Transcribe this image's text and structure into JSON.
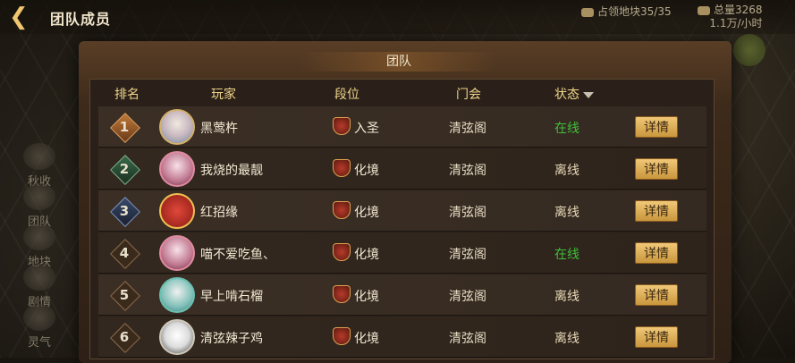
{
  "header": {
    "back_icon": "chevron-left-icon",
    "title": "团队成员",
    "territory": "占领地块35/35",
    "total": "总量3268",
    "rate": "1.1万/小时"
  },
  "side_menu": [
    "秋收",
    "团队",
    "地块",
    "剧情",
    "灵气"
  ],
  "panel": {
    "title": "团队",
    "columns": {
      "rank": "排名",
      "player": "玩家",
      "tier": "段位",
      "guild": "门会",
      "status": "状态"
    },
    "detail_label": "详情",
    "rows": [
      {
        "rank": "1",
        "name": "黑莺杵",
        "tier": "入圣",
        "guild": "清弦阁",
        "status": "在线"
      },
      {
        "rank": "2",
        "name": "我烧的最靓",
        "tier": "化境",
        "guild": "清弦阁",
        "status": "离线"
      },
      {
        "rank": "3",
        "name": "红招缘",
        "tier": "化境",
        "guild": "清弦阁",
        "status": "离线"
      },
      {
        "rank": "4",
        "name": "喵不爱吃鱼、",
        "tier": "化境",
        "guild": "清弦阁",
        "status": "在线"
      },
      {
        "rank": "5",
        "name": "早上啃石榴",
        "tier": "化境",
        "guild": "清弦阁",
        "status": "离线"
      },
      {
        "rank": "6",
        "name": "清弦辣子鸡",
        "tier": "化境",
        "guild": "清弦阁",
        "status": "离线"
      }
    ]
  },
  "colors": {
    "online": "#3fbf3a",
    "offline": "#e8dcc4",
    "header_text": "#f0d58a",
    "button": "#e0b060"
  }
}
